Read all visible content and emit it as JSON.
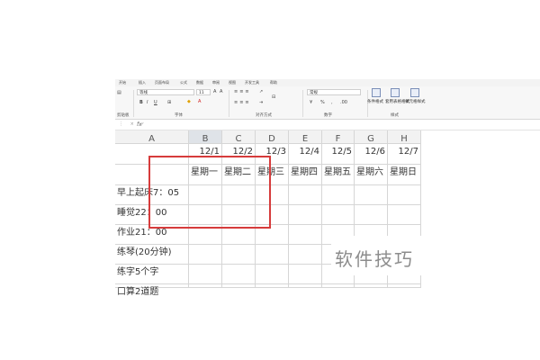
{
  "ribbon": {
    "tabs": [
      "开始",
      "插入",
      "页面布局",
      "公式",
      "数据",
      "审阅",
      "视图",
      "开发工具",
      "帮助"
    ],
    "font_name": "等线",
    "font_size": "11",
    "number_format": "常规",
    "groups": [
      "剪贴板",
      "字体",
      "对齐方式",
      "数字",
      "样式"
    ],
    "style_buttons": [
      "条件格式",
      "套用表格格式",
      "单元格样式"
    ],
    "bold": "B",
    "italic": "I",
    "underline": "U"
  },
  "formula_bar": {
    "controls": "⋮ × ✓",
    "fx": "fx"
  },
  "grid": {
    "columns": [
      "A",
      "B",
      "C",
      "D",
      "E",
      "F",
      "G",
      "H"
    ],
    "dates": [
      "12/1",
      "12/2",
      "12/3",
      "12/4",
      "12/5",
      "12/6",
      "12/7"
    ],
    "weekdays": [
      "星期一",
      "星期二",
      "星期三",
      "星期四",
      "星期五",
      "星期六",
      "星期日"
    ],
    "rows": [
      "早上起床7：05",
      "睡觉22：00",
      "作业21：00",
      "练琴(20分钟)",
      "练字5个字",
      "口算2道题"
    ]
  },
  "watermark": "软件技巧",
  "colors": {
    "annotation": "#d63b3b",
    "header_bg": "#f2f2f2",
    "gridline": "#d6d6d6"
  }
}
